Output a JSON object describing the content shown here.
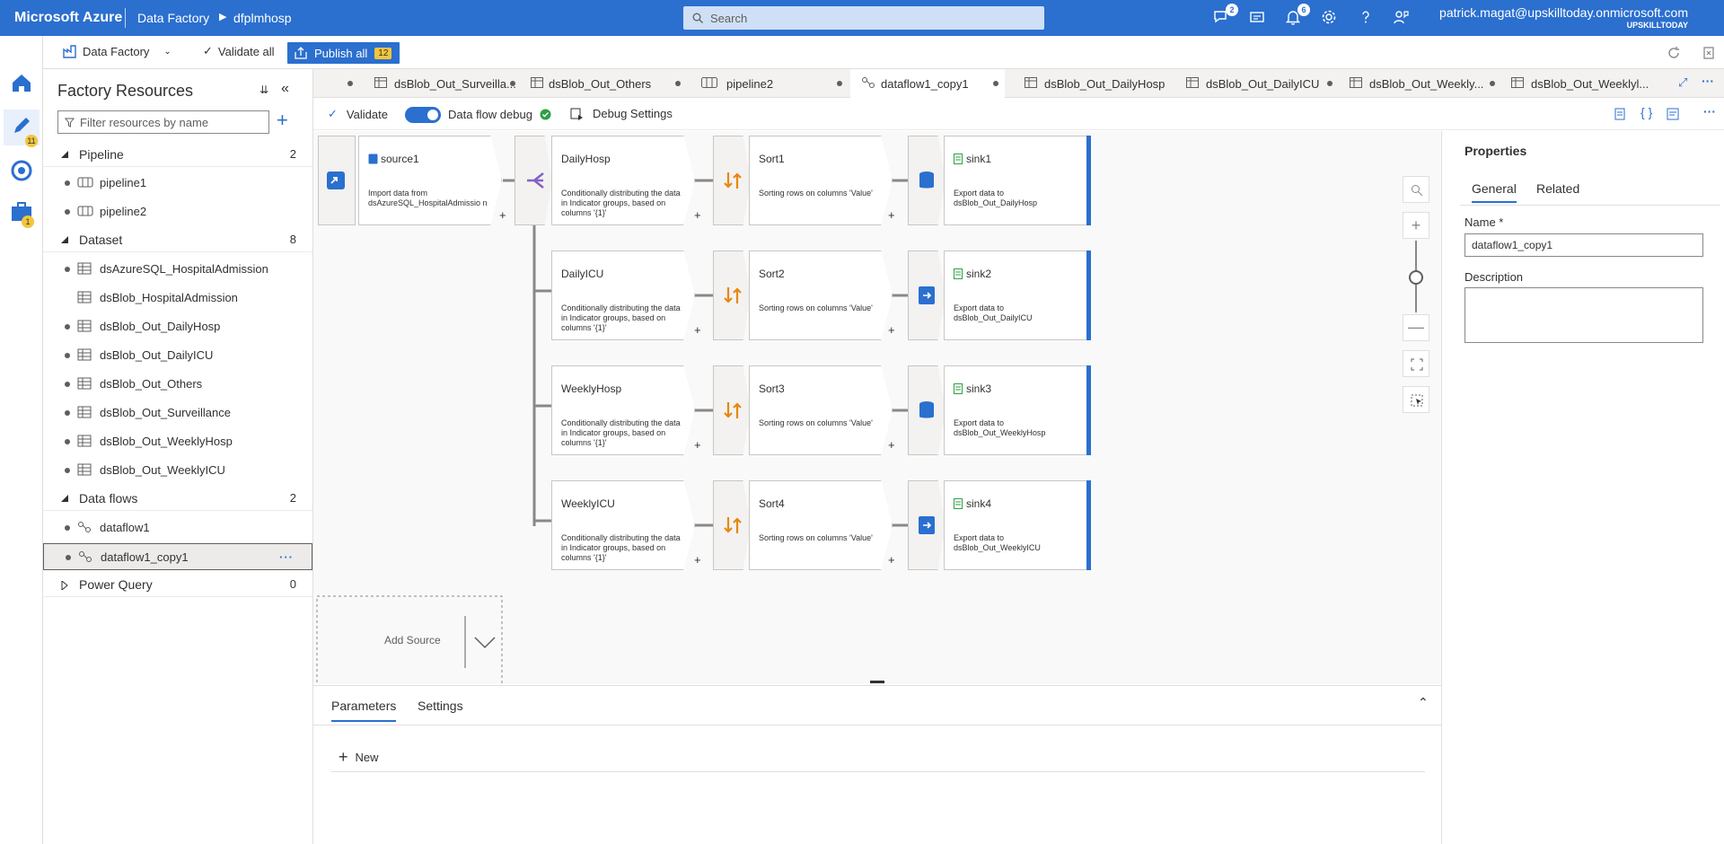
{
  "header": {
    "brand": "Microsoft Azure",
    "crumb_service": "Data Factory",
    "crumb_factory": "dfplmhosp",
    "search_placeholder": "Search",
    "notifications": [
      {
        "icon": "feedback-chat-icon",
        "count": "2"
      },
      {
        "icon": "directory-switch-icon",
        "count": ""
      },
      {
        "icon": "bell-icon",
        "count": "6"
      },
      {
        "icon": "gear-icon",
        "count": ""
      },
      {
        "icon": "help-icon",
        "count": ""
      },
      {
        "icon": "person-feedback-icon",
        "count": ""
      }
    ],
    "user_email": "patrick.magat@upskilltoday.onmicrosoft.com",
    "user_org": "UPSKILLTODAY"
  },
  "toolbar": {
    "factory_label": "Data Factory",
    "validate_all": "Validate all",
    "publish_all": "Publish all",
    "publish_count": "12"
  },
  "rail": {
    "author_badge": "11",
    "manage_badge": "1"
  },
  "resources": {
    "title": "Factory Resources",
    "filter_placeholder": "Filter resources by name",
    "categories": {
      "pipeline": {
        "label": "Pipeline",
        "count": "2",
        "items": [
          "pipeline1",
          "pipeline2"
        ]
      },
      "dataset": {
        "label": "Dataset",
        "count": "8",
        "items": [
          "dsAzureSQL_HospitalAdmission",
          "dsBlob_HospitalAdmission",
          "dsBlob_Out_DailyHosp",
          "dsBlob_Out_DailyICU",
          "dsBlob_Out_Others",
          "dsBlob_Out_Surveillance",
          "dsBlob_Out_WeeklyHosp",
          "dsBlob_Out_WeeklyICU"
        ]
      },
      "dataflows": {
        "label": "Data flows",
        "count": "2",
        "items": [
          "dataflow1",
          "dataflow1_copy1"
        ]
      },
      "powerquery": {
        "label": "Power Query",
        "count": "0"
      }
    }
  },
  "tabs": [
    "dsBlob_Out_Surveilla...",
    "dsBlob_Out_Others",
    "pipeline2",
    "dataflow1_copy1",
    "dsBlob_Out_DailyHosp",
    "dsBlob_Out_DailyICU",
    "dsBlob_Out_Weekly...",
    "dsBlob_Out_Weeklyl..."
  ],
  "dataflow_toolbar": {
    "validate": "Validate",
    "debug_label": "Data flow debug",
    "debug_settings": "Debug Settings"
  },
  "canvas": {
    "source": {
      "title": "source1",
      "desc": "Import data from dsAzureSQL_HospitalAdmissio n"
    },
    "rows": [
      {
        "split": "DailyHosp",
        "split_desc": "Conditionally distributing the data in Indicator groups, based on columns '{1}'",
        "sort": "Sort1",
        "sort_desc": "Sorting rows on columns 'Value'",
        "sink": "sink1",
        "sink_desc": "Export data to dsBlob_Out_DailyHosp"
      },
      {
        "split": "DailyICU",
        "split_desc": "Conditionally distributing the data in Indicator groups, based on columns '{1}'",
        "sort": "Sort2",
        "sort_desc": "Sorting rows on columns 'Value'",
        "sink": "sink2",
        "sink_desc": "Export data to dsBlob_Out_DailyICU"
      },
      {
        "split": "WeeklyHosp",
        "split_desc": "Conditionally distributing the data in Indicator groups, based on columns '{1}'",
        "sort": "Sort3",
        "sort_desc": "Sorting rows on columns 'Value'",
        "sink": "sink3",
        "sink_desc": "Export data to dsBlob_Out_WeeklyHosp"
      },
      {
        "split": "WeeklyICU",
        "split_desc": "Conditionally distributing the data in Indicator groups, based on columns '{1}'",
        "sort": "Sort4",
        "sort_desc": "Sorting rows on columns 'Value'",
        "sink": "sink4",
        "sink_desc": "Export data to dsBlob_Out_WeeklyICU"
      }
    ],
    "add_source": "Add Source"
  },
  "properties": {
    "title": "Properties",
    "tab_general": "General",
    "tab_related": "Related",
    "name_label": "Name *",
    "name_value": "dataflow1_copy1",
    "description_label": "Description"
  },
  "bottom": {
    "tab_parameters": "Parameters",
    "tab_settings": "Settings",
    "new_label": "New"
  },
  "colors": {
    "accent": "#2b6fcf",
    "badge": "#f3c53b",
    "sort_icon": "#e8870e",
    "split_icon": "#8661c5"
  }
}
